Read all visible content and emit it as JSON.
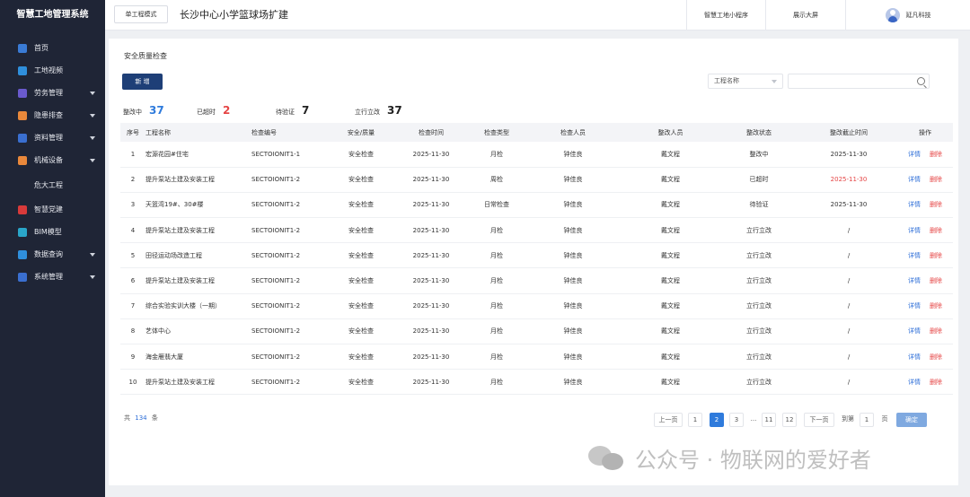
{
  "sidebar": {
    "brand": "智慧工地管理系统",
    "items": [
      {
        "label": "首页",
        "icon": "home-icon",
        "color": "#3a7bd5",
        "has_sub": false
      },
      {
        "label": "工地视频",
        "icon": "video-icon",
        "color": "#2f8fdc",
        "has_sub": false
      },
      {
        "label": "劳务管理",
        "icon": "labor-icon",
        "color": "#6a5acd",
        "has_sub": true
      },
      {
        "label": "隐患排查",
        "icon": "hazard-icon",
        "color": "#e9883b",
        "has_sub": true
      },
      {
        "label": "资料管理",
        "icon": "document-icon",
        "color": "#3a6fd0",
        "has_sub": true
      },
      {
        "label": "机械设备",
        "icon": "machine-icon",
        "color": "#e9883b",
        "has_sub": true
      },
      {
        "label": "危大工程",
        "icon": "",
        "color": "",
        "has_sub": false
      },
      {
        "label": "智慧党建",
        "icon": "party-icon",
        "color": "#d83a3a",
        "has_sub": false
      },
      {
        "label": "BIM模型",
        "icon": "bim-icon",
        "color": "#2aa6c9",
        "has_sub": false
      },
      {
        "label": "数据查询",
        "icon": "data-query-icon",
        "color": "#2f8fdc",
        "has_sub": true
      },
      {
        "label": "系统管理",
        "icon": "settings-icon",
        "color": "#3a6fd0",
        "has_sub": true
      }
    ]
  },
  "header": {
    "mode_button": "单工程模式",
    "project_title": "长沙中心小学篮球场扩建",
    "mini_program": "智慧工地小程序",
    "big_screen": "展示大屏",
    "user_name": "延凡科技"
  },
  "page": {
    "title": "安全质量检查",
    "add_button": "新 增",
    "filter_placeholder": "工程名称"
  },
  "stats": [
    {
      "label": "整改中",
      "value": "37",
      "color": "#2f7bdc"
    },
    {
      "label": "已超时",
      "value": "2",
      "color": "#e54545"
    },
    {
      "label": "待验证",
      "value": "7",
      "color": "#222222"
    },
    {
      "label": "立行立改",
      "value": "37",
      "color": "#222222"
    }
  ],
  "table": {
    "headers": [
      "序号",
      "工程名称",
      "检查编号",
      "安全/质量",
      "检查时间",
      "检查类型",
      "检查人员",
      "整改人员",
      "整改状态",
      "整改截止时间",
      "操作"
    ],
    "detail_label": "详情",
    "delete_label": "删除",
    "rows": [
      {
        "idx": "1",
        "name": "宏源花园#住宅",
        "code": "SECTOIONIT1-1",
        "kind": "安全检查",
        "time": "2025-11-30",
        "type": "月检",
        "inspector": "钟佳良",
        "rectifier": "戴文程",
        "status": "整改中",
        "deadline": "2025-11-30",
        "deadline_overdue": false
      },
      {
        "idx": "2",
        "name": "提升泵站土建及安装工程",
        "code": "SECTOIONIT1-2",
        "kind": "安全检查",
        "time": "2025-11-30",
        "type": "周检",
        "inspector": "钟佳良",
        "rectifier": "戴文程",
        "status": "已超时",
        "deadline": "2025-11-30",
        "deadline_overdue": true
      },
      {
        "idx": "3",
        "name": "天篮湾19#、30#楼",
        "code": "SECTOIONIT1-2",
        "kind": "安全检查",
        "time": "2025-11-30",
        "type": "日常检查",
        "inspector": "钟佳良",
        "rectifier": "戴文程",
        "status": "待验证",
        "deadline": "2025-11-30",
        "deadline_overdue": false
      },
      {
        "idx": "4",
        "name": "提升泵站土建及安装工程",
        "code": "SECTOIONIT1-2",
        "kind": "安全检查",
        "time": "2025-11-30",
        "type": "月检",
        "inspector": "钟佳良",
        "rectifier": "戴文程",
        "status": "立行立改",
        "deadline": "/",
        "deadline_overdue": false
      },
      {
        "idx": "5",
        "name": "田径运动场改造工程",
        "code": "SECTOIONIT1-2",
        "kind": "安全检查",
        "time": "2025-11-30",
        "type": "月检",
        "inspector": "钟佳良",
        "rectifier": "戴文程",
        "status": "立行立改",
        "deadline": "/",
        "deadline_overdue": false
      },
      {
        "idx": "6",
        "name": "提升泵站土建及安装工程",
        "code": "SECTOIONIT1-2",
        "kind": "安全检查",
        "time": "2025-11-30",
        "type": "月检",
        "inspector": "钟佳良",
        "rectifier": "戴文程",
        "status": "立行立改",
        "deadline": "/",
        "deadline_overdue": false
      },
      {
        "idx": "7",
        "name": "综合实验实训大楼（一期）",
        "code": "SECTOIONIT1-2",
        "kind": "安全检查",
        "time": "2025-11-30",
        "type": "月检",
        "inspector": "钟佳良",
        "rectifier": "戴文程",
        "status": "立行立改",
        "deadline": "/",
        "deadline_overdue": false
      },
      {
        "idx": "8",
        "name": "艺体中心",
        "code": "SECTOIONIT1-2",
        "kind": "安全检查",
        "time": "2025-11-30",
        "type": "月检",
        "inspector": "钟佳良",
        "rectifier": "戴文程",
        "status": "立行立改",
        "deadline": "/",
        "deadline_overdue": false
      },
      {
        "idx": "9",
        "name": "海金雁翡大厦",
        "code": "SECTOIONIT1-2",
        "kind": "安全检查",
        "time": "2025-11-30",
        "type": "月检",
        "inspector": "钟佳良",
        "rectifier": "戴文程",
        "status": "立行立改",
        "deadline": "/",
        "deadline_overdue": false
      },
      {
        "idx": "10",
        "name": "提升泵站土建及安装工程",
        "code": "SECTOIONIT1-2",
        "kind": "安全检查",
        "time": "2025-11-30",
        "type": "月检",
        "inspector": "钟佳良",
        "rectifier": "戴文程",
        "status": "立行立改",
        "deadline": "/",
        "deadline_overdue": false
      }
    ]
  },
  "pagination": {
    "total_prefix": "共",
    "total": "134",
    "total_suffix": "条",
    "prev": "上一页",
    "pages": [
      "1",
      "2",
      "3",
      "...",
      "11",
      "12"
    ],
    "current": "2",
    "next": "下一页",
    "goto_label": "到第",
    "goto_value": "1",
    "page_unit": "页",
    "confirm": "确定"
  },
  "watermark": "公众号 · 物联网的爱好者"
}
